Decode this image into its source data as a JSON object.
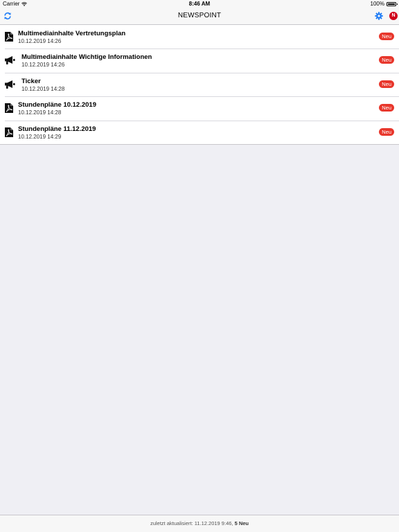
{
  "status_bar": {
    "carrier": "Carrier",
    "time": "8:46 AM",
    "battery": "100%",
    "battery_level": 1.0
  },
  "nav": {
    "title": "NEWSPOINT",
    "refresh_icon": "refresh-icon",
    "settings_icon": "gear-icon",
    "avatar_letter": "N",
    "accent_color": "#1f7cf6",
    "avatar_color": "#d0021b"
  },
  "items": [
    {
      "icon": "pdf-icon",
      "title": "Multimediainhalte Vertretungsplan",
      "date": "10.12.2019 14:26",
      "badge": "Neu"
    },
    {
      "icon": "megaphone-icon",
      "title": "Multimediainhalte Wichtige Informationen",
      "date": "10.12.2019 14:26",
      "badge": "Neu"
    },
    {
      "icon": "megaphone-icon",
      "title": "Ticker",
      "date": "10.12.2019 14:28",
      "badge": "Neu"
    },
    {
      "icon": "pdf-icon",
      "title": "Stundenpläne 10.12.2019",
      "date": "10.12.2019 14:28",
      "badge": "Neu"
    },
    {
      "icon": "pdf-icon",
      "title": "Stundenpläne 11.12.2019",
      "date": "10.12.2019 14:29",
      "badge": "Neu"
    }
  ],
  "footer": {
    "prefix": "zuletzt aktualisiert: 11.12.2019 9:46, ",
    "count": "5 Neu"
  },
  "badge_color": "#e8372c"
}
